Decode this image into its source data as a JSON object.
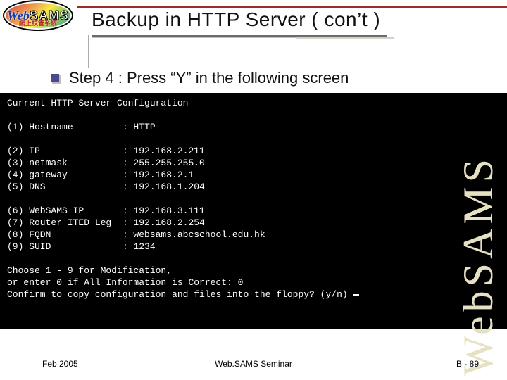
{
  "logo": {
    "web": "Web",
    "sams": "SAMS",
    "sub": "網上校管系統"
  },
  "title": "Backup in HTTP Server ( con’t )",
  "bullet": "Step 4 : Press “Y” in the following screen",
  "term": {
    "l0": "Current HTTP Server Configuration",
    "l1": "(1) Hostname         : HTTP",
    "l2": "(2) IP               : 192.168.2.211",
    "l3": "(3) netmask          : 255.255.255.0",
    "l4": "(4) gateway          : 192.168.2.1",
    "l5": "(5) DNS              : 192.168.1.204",
    "l6": "(6) WebSAMS IP       : 192.168.3.111",
    "l7": "(7) Router ITED Leg  : 192.168.2.254",
    "l8": "(8) FQDN             : websams.abcschool.edu.hk",
    "l9": "(9) SUID             : 1234",
    "l10": "Choose 1 - 9 for Modification,",
    "l11": "or enter 0 if All Information is Correct: 0",
    "l12": "Confirm to copy configuration and files into the floppy? (y/n)"
  },
  "watermark": "WebSAMS",
  "footer": {
    "left": "Feb 2005",
    "center": "Web.SAMS Seminar",
    "right": "B - 89"
  }
}
